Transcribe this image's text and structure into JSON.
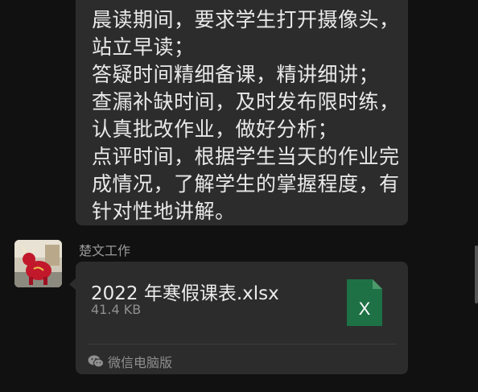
{
  "message": {
    "lines": [
      "晨读期间，要求学生打开摄像头，",
      "站立早读；",
      "答疑时间精细备课，精讲细讲；",
      "查漏补缺时间，及时发布限时练，",
      "认真批改作业，做好分析；",
      "点评时间，根据学生当天的作业完",
      "成情况，了解学生的掌握程度，有",
      "针对性地讲解。"
    ]
  },
  "sender": {
    "name": "楚文工作"
  },
  "file": {
    "name": "2022 年寒假课表.xlsx",
    "size": "41.4 KB",
    "icon_letter": "X",
    "icon_color": "#1e7145",
    "source": "微信电脑版"
  }
}
